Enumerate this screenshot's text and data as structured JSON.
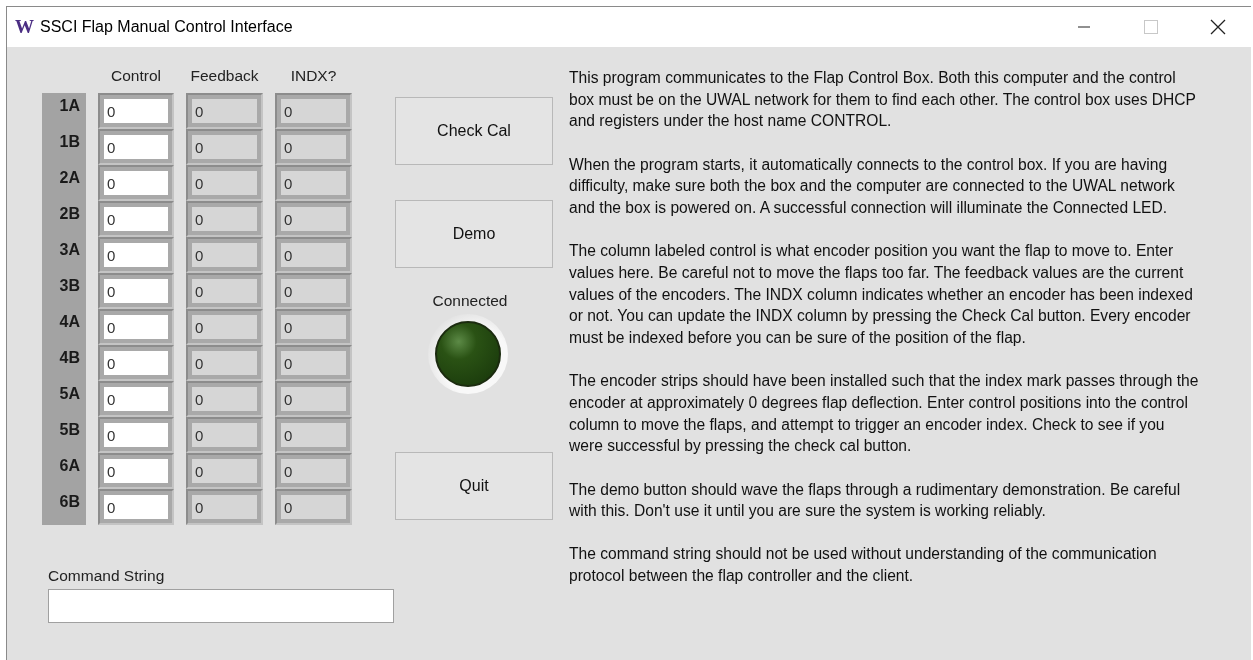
{
  "window": {
    "logo": "W",
    "title": "SSCI Flap Manual Control Interface",
    "controls": [
      {
        "kind": "minimize",
        "disabled": false
      },
      {
        "kind": "maximize",
        "disabled": true
      },
      {
        "kind": "close",
        "disabled": false
      }
    ]
  },
  "table": {
    "columns": [
      "Control",
      "Feedback",
      "INDX?"
    ],
    "rows": [
      {
        "label": "1A",
        "control": "0",
        "feedback": "0",
        "indx": "0"
      },
      {
        "label": "1B",
        "control": "0",
        "feedback": "0",
        "indx": "0"
      },
      {
        "label": "2A",
        "control": "0",
        "feedback": "0",
        "indx": "0"
      },
      {
        "label": "2B",
        "control": "0",
        "feedback": "0",
        "indx": "0"
      },
      {
        "label": "3A",
        "control": "0",
        "feedback": "0",
        "indx": "0"
      },
      {
        "label": "3B",
        "control": "0",
        "feedback": "0",
        "indx": "0"
      },
      {
        "label": "4A",
        "control": "0",
        "feedback": "0",
        "indx": "0"
      },
      {
        "label": "4B",
        "control": "0",
        "feedback": "0",
        "indx": "0"
      },
      {
        "label": "5A",
        "control": "0",
        "feedback": "0",
        "indx": "0"
      },
      {
        "label": "5B",
        "control": "0",
        "feedback": "0",
        "indx": "0"
      },
      {
        "label": "6A",
        "control": "0",
        "feedback": "0",
        "indx": "0"
      },
      {
        "label": "6B",
        "control": "0",
        "feedback": "0",
        "indx": "0"
      }
    ]
  },
  "buttons": [
    {
      "label": "Check Cal"
    },
    {
      "label": "Demo"
    }
  ],
  "led": {
    "label": "Connected",
    "on": false
  },
  "quit_button": {
    "label": "Quit"
  },
  "command_string": {
    "label": "Command String"
  },
  "help_text": [
    "This program communicates to the Flap Control Box. Both this computer and the control box must be on the UWAL network for them to find each other. The control box uses DHCP and registers under the host name CONTROL.",
    "When the program starts, it automatically connects to the control box. If you are having difficulty, make sure both the box and the computer are connected to the UWAL network and the box is powered on. A successful connection will illuminate the Connected LED.",
    "The column labeled control is what encoder position you want the flap to move to. Enter values here. Be careful not to move the flaps too far. The feedback values are the current values of the encoders. The INDX column indicates whether an encoder has been indexed or not. You can update the INDX column by pressing the Check Cal button. Every encoder must be indexed before you can be sure of the position of the flap.",
    "The encoder strips should have been installed such that the index mark passes through the encoder at approximately 0 degrees flap deflection. Enter control positions into the control column to move the flaps, and attempt to trigger an encoder index. Check to see if you were successful by pressing the check cal button.",
    "The demo button should wave the flaps through a rudimentary demonstration. Be careful with this. Don't use it until you are sure the system is working reliably.",
    "The command string should not be used without understanding of the communication protocol between the flap controller and the client."
  ]
}
